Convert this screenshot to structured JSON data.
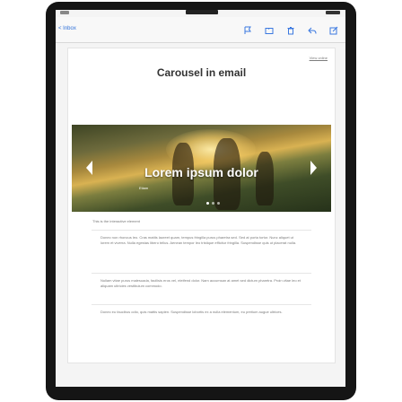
{
  "nav": {
    "back_label": "< Inbox",
    "icons": [
      "flag-icon",
      "folder-icon",
      "trash-icon",
      "reply-icon",
      "compose-icon"
    ]
  },
  "email": {
    "view_online": "View online",
    "title": "Carousel in email",
    "carousel": {
      "slide_heading": "Lorem ipsum dolor",
      "slide_button": "Etiam",
      "active_slide": 1,
      "slide_count": 3
    },
    "caption": "This is the interactive element",
    "paragraphs": [
      "Donec non rhoncus leo. Cras mattis laoreet quam, tempus fringilla purus pharetra sed. Sed at porta tortor. Nunc aliquet ut lorem et viverra. Nulla egestas libero tellus. Aenean tempor leo tristique efficitur fringilla. Suspendisse quis ut placerat nulla.",
      "Nullam vitae purus malesuada, facilisis eros vel, eleifend dolor. Nam accumsan at amet sed dictum pharetra. Proin vitae leo et aliquam ultricies vestibulum commodo.",
      "Donec eu faucibus odio, quis mattis sapien. Suspendisse lobortis ex a nulla elementum, eu pretium augue ultrices."
    ]
  }
}
